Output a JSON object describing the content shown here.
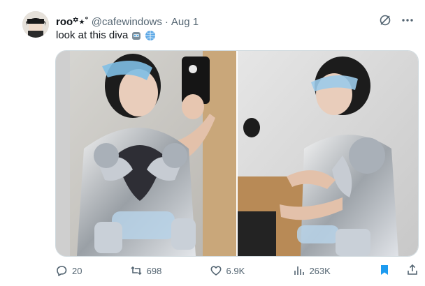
{
  "post": {
    "display_name": "roo꙳⋆˚",
    "handle": "@cafewindows",
    "separator": "·",
    "date": "Aug 1",
    "text": "look at this diva",
    "emojis": [
      "robot-face-emoji",
      "globe-emoji"
    ]
  },
  "media": {
    "images": [
      {
        "name": "mirror-selfie-photo"
      },
      {
        "name": "side-profile-photo"
      }
    ]
  },
  "actions": {
    "replies": "20",
    "reposts": "698",
    "likes": "6.9K",
    "views": "263K"
  },
  "icons": {
    "grok": "grok-icon",
    "more": "more-icon",
    "reply": "reply-icon",
    "repost": "repost-icon",
    "like": "like-icon",
    "views": "views-icon",
    "bookmark": "bookmark-icon",
    "share": "share-icon"
  },
  "colors": {
    "text": "#0f1419",
    "muted": "#536471",
    "bookmark_active": "#1d9bf0",
    "border": "#cfd9de"
  }
}
